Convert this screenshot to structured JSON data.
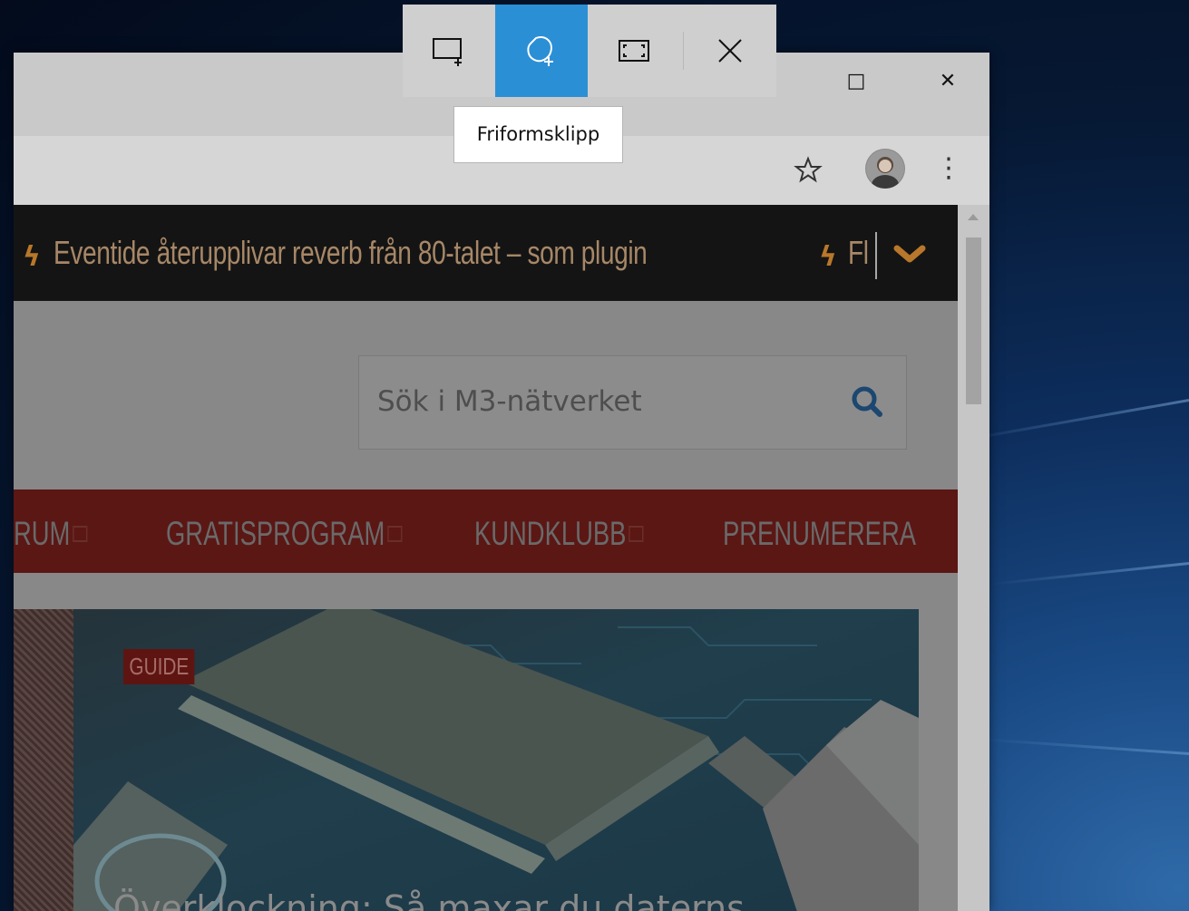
{
  "window": {
    "maximize_glyph": "□",
    "close_glyph": "✕"
  },
  "toolbar": {
    "menu_glyph": "⋮"
  },
  "ticker": {
    "headline1": "Eventide återupplivar reverb från 80-talet – som plugin",
    "headline2": "Fl"
  },
  "search": {
    "placeholder": "Sök i M3-nätverket"
  },
  "nav": {
    "items": [
      "RUM",
      "GRATISPROGRAM",
      "KUNDKLUBB",
      "PRENUMERERA"
    ]
  },
  "hero": {
    "badge": "GUIDE",
    "title": "Överklockning: Så maxar du daterns"
  },
  "snip": {
    "tooltip": "Friformsklipp",
    "selected_mode": "free-form"
  },
  "colors": {
    "snip_selected": "#2b8fd6",
    "nav_red": "#5b1714",
    "ticker_text": "#a78767"
  }
}
